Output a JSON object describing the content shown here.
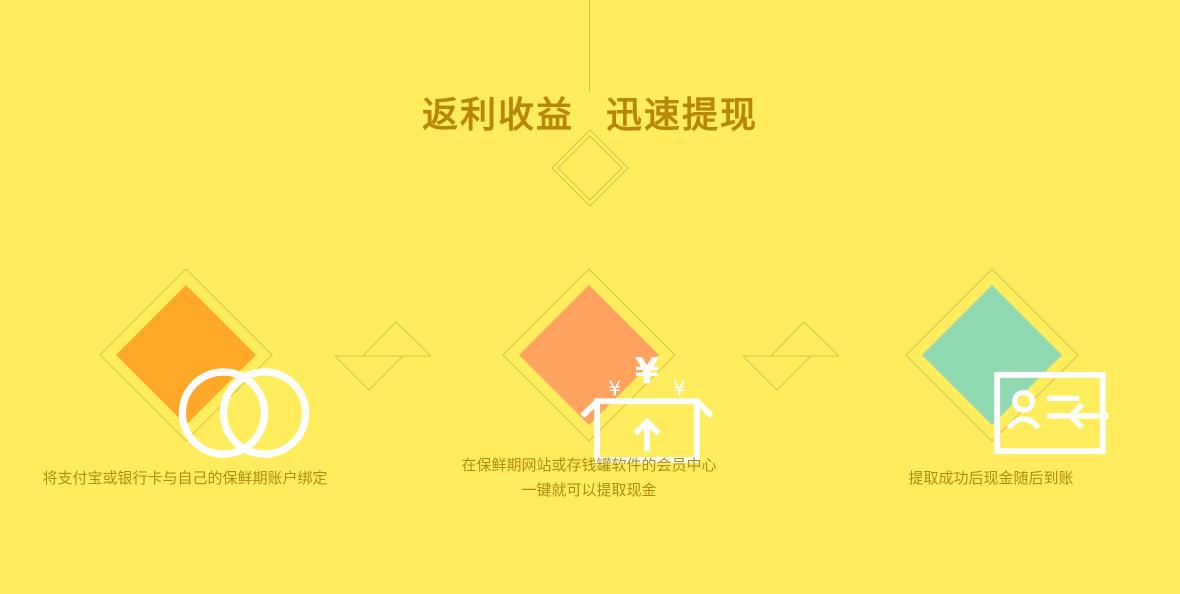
{
  "title": {
    "part1": "返利收益",
    "part2": "迅速提现"
  },
  "steps": [
    {
      "icon": "linked-rings-icon",
      "color": "#ffa726",
      "caption_lines": [
        "将支付宝或银行卡与自己的保鲜期账户绑定"
      ]
    },
    {
      "icon": "money-box-icon",
      "color": "#ffa25e",
      "caption_lines": [
        "在保鲜期网站或存钱罐软件的会员中心",
        "一键就可以提取现金"
      ]
    },
    {
      "icon": "id-card-arrow-icon",
      "color": "#91d9b0",
      "caption_lines": [
        "提取成功后现金随后到账"
      ]
    }
  ],
  "colors": {
    "background": "#ffed5e",
    "title": "#b8860b",
    "caption": "#b38a12",
    "outline": "#d9c24a"
  }
}
